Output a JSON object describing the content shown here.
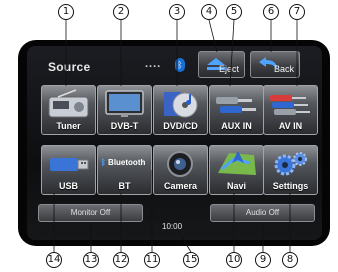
{
  "header": {
    "title": "Source",
    "dots": "....",
    "bluetooth_icon": "bluetooth-icon",
    "eject_label": "Eject",
    "back_label": "Back"
  },
  "sources_row1": [
    {
      "label": "Tuner",
      "icon": "radio-icon"
    },
    {
      "label": "DVB-T",
      "icon": "tv-icon"
    },
    {
      "label": "DVD/CD",
      "icon": "disc-icon"
    },
    {
      "label": "AUX IN",
      "icon": "aux-cable-icon"
    },
    {
      "label": "AV IN",
      "icon": "av-cable-icon"
    }
  ],
  "sources_row2": [
    {
      "label": "USB",
      "icon": "usb-icon"
    },
    {
      "label": "BT",
      "icon": "bluetooth-logo-icon",
      "logo_text": "Bluetooth"
    },
    {
      "label": "Camera",
      "icon": "camera-icon"
    },
    {
      "label": "Navi",
      "icon": "navigation-icon"
    },
    {
      "label": "Settings",
      "icon": "gears-icon"
    }
  ],
  "footer": {
    "monitor_off_label": "Monitor Off",
    "audio_off_label": "Audio Off",
    "clock": "10:00"
  },
  "callouts": {
    "top": [
      "1",
      "2",
      "3",
      "4",
      "5",
      "6",
      "7"
    ],
    "bottom": [
      "14",
      "13",
      "12",
      "11",
      "15",
      "10",
      "9",
      "8"
    ]
  },
  "colors": {
    "bezel": "#050505",
    "screen": "#15171a",
    "tile_top": "#8e9196",
    "tile_bottom": "#2a2c30",
    "bluetooth_blue": "#1a6fd6"
  }
}
